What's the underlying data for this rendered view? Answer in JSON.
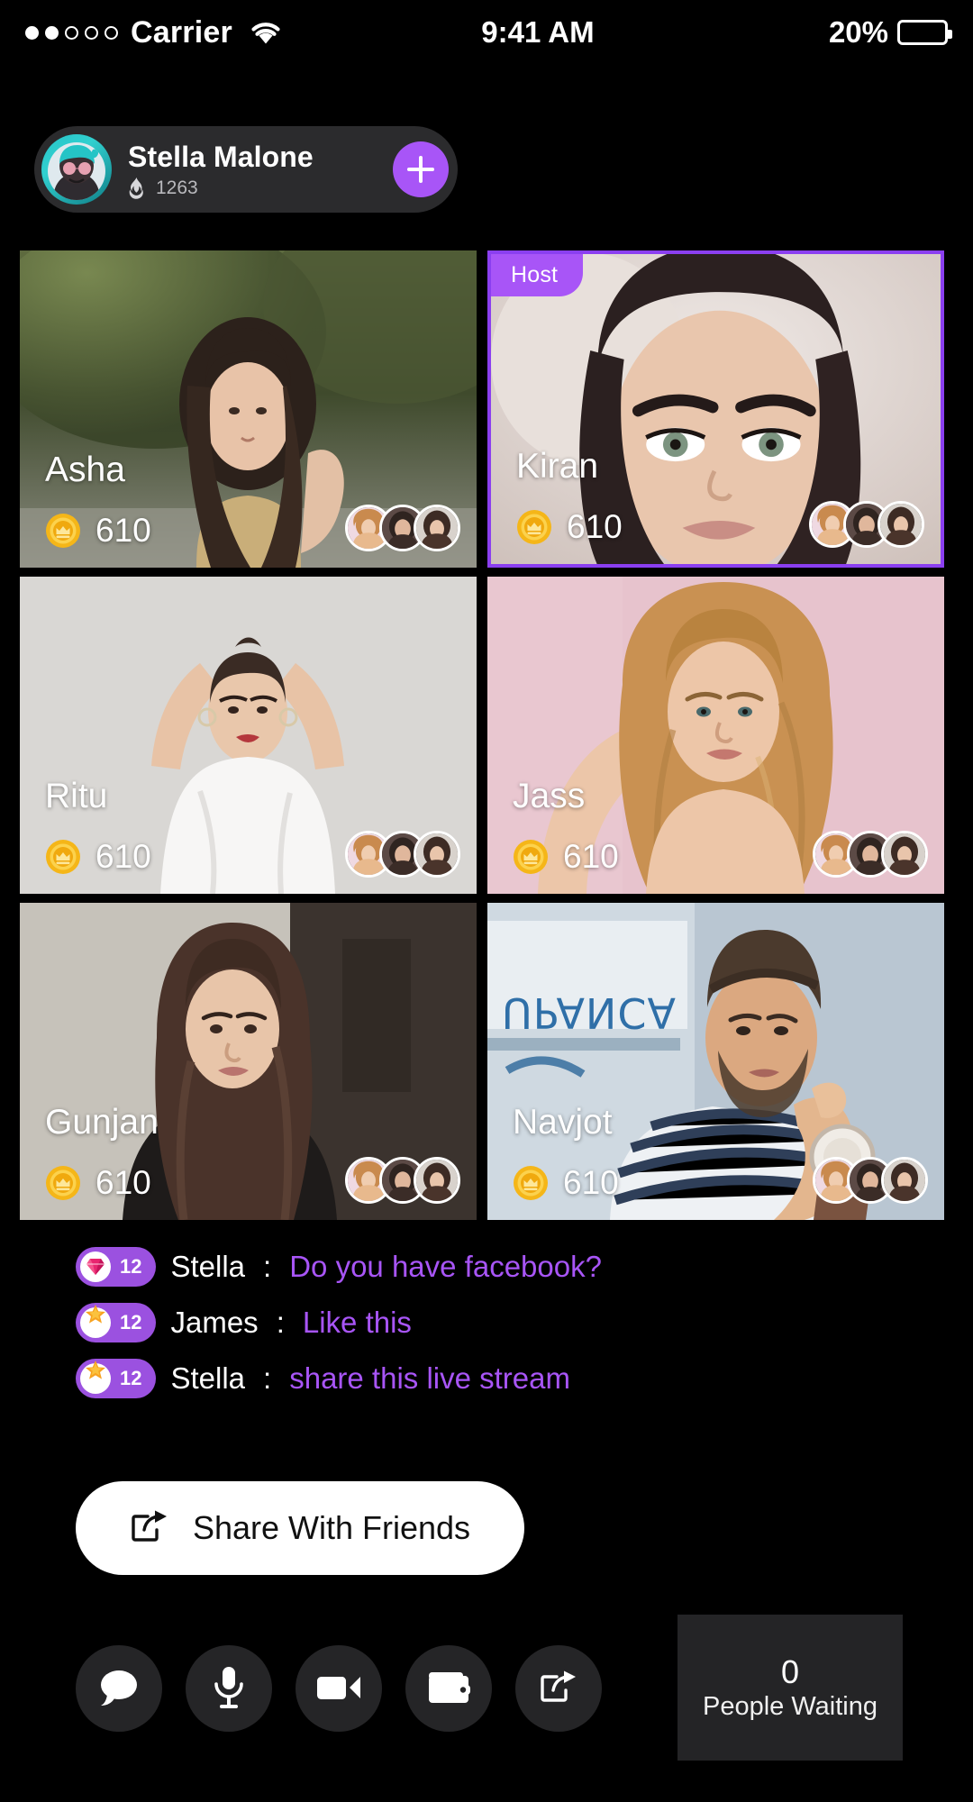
{
  "status_bar": {
    "carrier": "Carrier",
    "time": "9:41 AM",
    "battery": "20%",
    "signal_filled": 2,
    "signal_total": 5,
    "wifi_icon": "wifi-icon",
    "battery_icon": "battery-icon"
  },
  "host_pill": {
    "name": "Stella Malone",
    "flame_icon": "flame-icon",
    "flame_count": "1263",
    "add_label": "+",
    "accent_color": "#a855f7",
    "background_color": "#2b2b2d"
  },
  "grid": {
    "host_badge_label": "Host",
    "host_border_color": "#8b3ff0",
    "coin_icon": "coin-icon",
    "tiles": [
      {
        "name": "Asha",
        "coins": "610",
        "is_host": false
      },
      {
        "name": "Kiran",
        "coins": "610",
        "is_host": true
      },
      {
        "name": "Ritu",
        "coins": "610",
        "is_host": false
      },
      {
        "name": "Jass",
        "coins": "610",
        "is_host": false
      },
      {
        "name": "Gunjan",
        "coins": "610",
        "is_host": false
      },
      {
        "name": "Navjot",
        "coins": "610",
        "is_host": false
      }
    ]
  },
  "chat": {
    "messages": [
      {
        "gift_icon": "diamond-gem-icon",
        "gift_count": "12",
        "user": "Stella",
        "separator": ":",
        "text": "Do you have facebook?"
      },
      {
        "gift_icon": "star-egg-icon",
        "gift_count": "12",
        "user": "James",
        "separator": ":",
        "text": "Like this"
      },
      {
        "gift_icon": "star-egg-icon",
        "gift_count": "12",
        "user": "Stella",
        "separator": ":",
        "text": "share this live stream"
      }
    ],
    "badge_color": "#9b51e0",
    "message_color": "#a855f7"
  },
  "share_button": {
    "label": "Share With Friends",
    "icon": "share-icon"
  },
  "bottom_bar": {
    "buttons": [
      {
        "icon": "chat-bubble-icon"
      },
      {
        "icon": "microphone-icon"
      },
      {
        "icon": "video-camera-icon"
      },
      {
        "icon": "wallet-icon"
      },
      {
        "icon": "share-icon"
      }
    ]
  },
  "waiting_panel": {
    "count": "0",
    "label": "People Waiting"
  }
}
